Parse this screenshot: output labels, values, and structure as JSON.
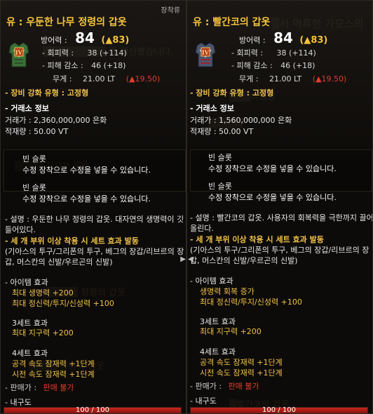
{
  "left": {
    "equip_tag": "장착류",
    "name": "유 : 우둔한 나무 정령의 갑옷",
    "icon_grade": "IV",
    "defense_label": "방어력 :",
    "defense_value": "84",
    "defense_bonus": "(▲83)",
    "evasion_label": "- 회피력 :",
    "evasion_value": "38 (+114)",
    "dr_label": "- 피해 감소 :",
    "dr_value": "46 (+18)",
    "weight_label": "무게 :",
    "weight_value": "21.00 LT",
    "weight_diff": "(▲19.50)",
    "enhance_type": "- 장비 강화 유형 : 고정형",
    "market_header": "- 거래소 정보",
    "market_price": "거래가 : 2,360,000,000 은화",
    "market_weight": "적재량 : 50.00 VT",
    "slot1_title": "빈 슬롯",
    "slot1_desc": "수정 장착으로 수정을 넣을 수 있습니다.",
    "slot2_title": "빈 슬롯",
    "slot2_desc": "수정 장착으로 수정을 넣을 수 있습니다.",
    "desc_line1": "- 설명 : 우둔한 나무 정령의 갑옷. 대자연의 생명력이 깃",
    "desc_line2": "들어있다.",
    "set_header": "- 세 개 부위 이상 착용 시 세트 효과 발동",
    "set_items_1": "(기아스의 투구/그리폰의 투구, 베그의 장갑/리브르의 장",
    "set_items_2": "갑, 머스칸의 신발/우르곤의 신발)",
    "item_effect_header": "- 아이템 효과",
    "item_effect_1": "최대 생명력 +200",
    "item_effect_2": "최대 정신력/투지/신성력 +100",
    "set3_header": "3세트 효과",
    "set3_effect_1": "최대 지구력 +200",
    "set4_header": "4세트 효과",
    "set4_effect_1": "공격 속도 잠재력 +1단계",
    "set4_effect_2": "시전 속도 잠재력 +1단계",
    "sell_label": "- 판매가 :",
    "sell_value": "판매 불가",
    "durability_label": "- 내구도",
    "durability_text": "100 / 100",
    "durability_fraction": 1.0
  },
  "right": {
    "name": "유 : 빨간코의 갑옷",
    "icon_grade": "IV",
    "defense_label": "방어력 :",
    "defense_value": "84",
    "defense_bonus": "(▲83)",
    "evasion_label": "- 회피력 :",
    "evasion_value": "38 (+114)",
    "dr_label": "- 피해 감소 :",
    "dr_value": "46 (+18)",
    "weight_label": "무게 :",
    "weight_value": "21.00 LT",
    "weight_diff": "(▲19.50)",
    "enhance_type": "- 장비 강화 유형 : 고정형",
    "market_header": "- 거래소 정보",
    "market_price": "거래가 : 1,560,000,000 은화",
    "market_weight": "적재량 : 50.00 VT",
    "slot1_title": "빈 슬롯",
    "slot1_desc": "수정 장착으로 수정을 넣을 수 있습니다.",
    "slot2_title": "빈 슬롯",
    "slot2_desc": "수정 장착으로 수정을 넣을 수 있습니다.",
    "desc_line1": "- 설명 : 빨간코의 갑옷. 사용자의 회복력을 극한까지 끌어",
    "desc_line2": "올린다.",
    "set_header": "- 세 개 부위 이상 착용 시 세트 효과 발동",
    "set_items_1": "(기아스의 투구/그리폰의 투구, 베그의 장갑/리브르의 장",
    "set_items_2": "갑, 머스칸의 신발/우르곤의 신발)",
    "item_effect_header": "- 아이템 효과",
    "item_effect_1": "생명력 회복 증가",
    "item_effect_2": "최대 정신력/투지/신성력 +100",
    "set3_header": "3세트 효과",
    "set3_effect_1": "최대 지구력 +200",
    "set4_header": "4세트 효과",
    "set4_effect_1": "공격 속도 잠재력 +1단계",
    "set4_effect_2": "시전 속도 잠재력 +1단계",
    "sell_label": "- 판매가 :",
    "sell_value": "판매 불가",
    "durability_label": "- 내구도",
    "durability_text": "100 / 100",
    "durability_fraction": 1.0
  },
  "colors": {
    "name_gold": "#f5c43b",
    "set_yellow": "#f0c24a",
    "weight_red": "#e23c2c",
    "durability_red": "#c9261b",
    "icon_green": "#3c6e3a",
    "icon_steel": "#4a5570"
  }
}
